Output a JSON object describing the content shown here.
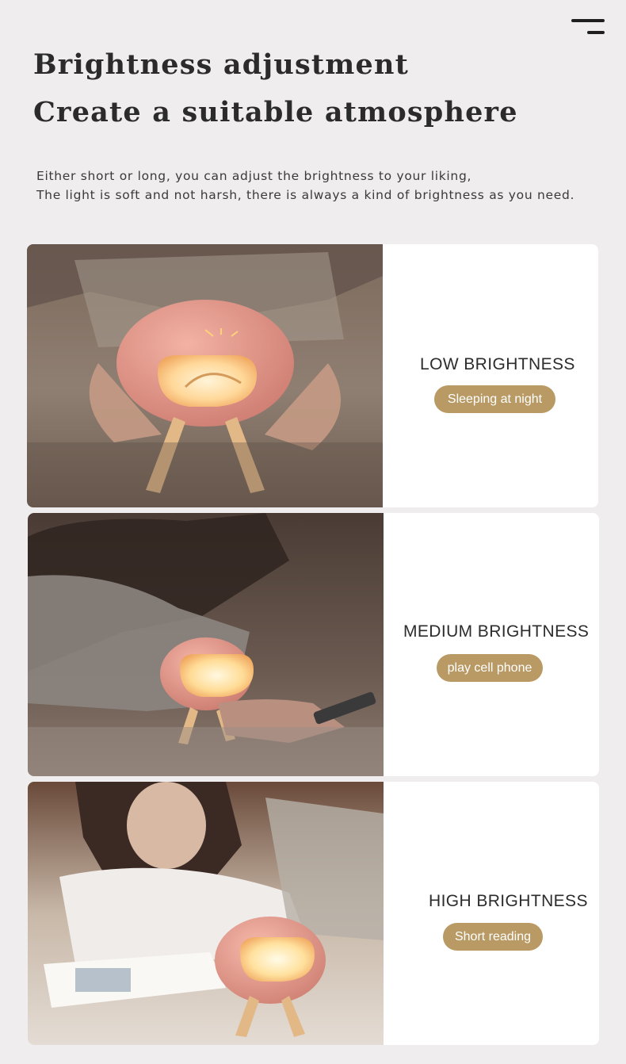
{
  "header": {
    "menu_icon": "hamburger-menu-icon",
    "title_line1": "Brightness adjustment",
    "title_line2": "Create a suitable atmosphere"
  },
  "intro": {
    "line1": "Either short or long, you can adjust the brightness to your liking,",
    "line2": "The light is soft and not harsh, there is always a kind of brightness as you need."
  },
  "modes": [
    {
      "title": "LOW BRIGHTNESS",
      "tag": "Sleeping at night"
    },
    {
      "title": "MEDIUM BRIGHTNESS",
      "tag": "play cell phone"
    },
    {
      "title": "HIGH BRIGHTNESS",
      "tag": "Short reading"
    }
  ],
  "colors": {
    "page_background": "#efeded",
    "card_background": "#ffffff",
    "tag_background": "#b99a64",
    "lamp_pink": "#e79a8c",
    "glow": "#ffd27a"
  }
}
